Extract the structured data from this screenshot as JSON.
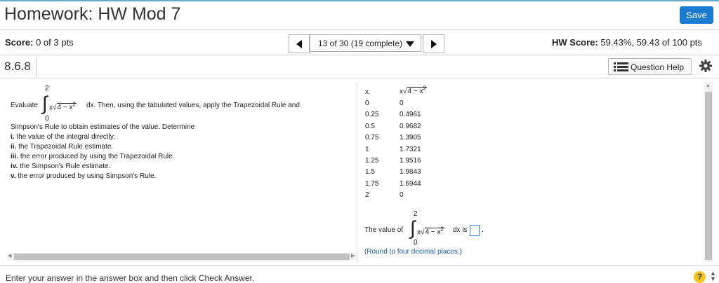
{
  "header": {
    "title": "Homework: HW Mod 7",
    "save_label": "Save",
    "accent_color": "#1a7bd0"
  },
  "score_bar": {
    "score_label": "Score:",
    "score_value": "0 of 3 pts",
    "nav_selector": "13 of 30 (19 complete)",
    "hw_score_label": "HW Score:",
    "hw_score_value": "59.43%, 59.43 of 100 pts"
  },
  "question_bar": {
    "question_number": "8.6.8",
    "help_label": "Question Help"
  },
  "problem": {
    "lead": "Evaluate",
    "upper_limit": "2",
    "lower_limit": "0",
    "integrand_x": "x",
    "radicand": "4 − x",
    "exponent": "2",
    "line1_rest": "dx. Then, using the tabulated values, apply the Trapezoidal Rule and",
    "line2": "Simpson's Rule to obtain estimates of the value. Determine",
    "items": [
      {
        "num": "i.",
        "text": "the value of the integral directly."
      },
      {
        "num": "ii.",
        "text": "the Trapezoidal Rule estimate."
      },
      {
        "num": "iii.",
        "text": "the error produced by using the Trapezoidal Rule."
      },
      {
        "num": "iv.",
        "text": "the Simpson's Rule estimate."
      },
      {
        "num": "v.",
        "text": "the error produced by using Simpson's Rule."
      }
    ]
  },
  "table": {
    "col1_header": "x",
    "col2_x": "x",
    "col2_radicand": "4 − x",
    "col2_exp": "2",
    "rows": [
      {
        "x": "0",
        "y": "0"
      },
      {
        "x": "0.25",
        "y": "0.4961"
      },
      {
        "x": "0.5",
        "y": "0.9682"
      },
      {
        "x": "0.75",
        "y": "1.3905"
      },
      {
        "x": "1",
        "y": "1.7321"
      },
      {
        "x": "1.25",
        "y": "1.9516"
      },
      {
        "x": "1.5",
        "y": "1.9843"
      },
      {
        "x": "1.75",
        "y": "1.6944"
      },
      {
        "x": "2",
        "y": "0"
      }
    ]
  },
  "answer": {
    "lead": "The value of",
    "upper": "2",
    "lower": "0",
    "integrand_x": "x",
    "radicand": "4 − x",
    "exponent": "2",
    "tail": "dx is",
    "period": ".",
    "value": "",
    "hint": "(Round to four decimal places.)"
  },
  "footer": {
    "instruction": "Enter your answer in the answer box and then click Check Answer.",
    "help_glyph": "?",
    "updown_glyph": "▲▼"
  }
}
